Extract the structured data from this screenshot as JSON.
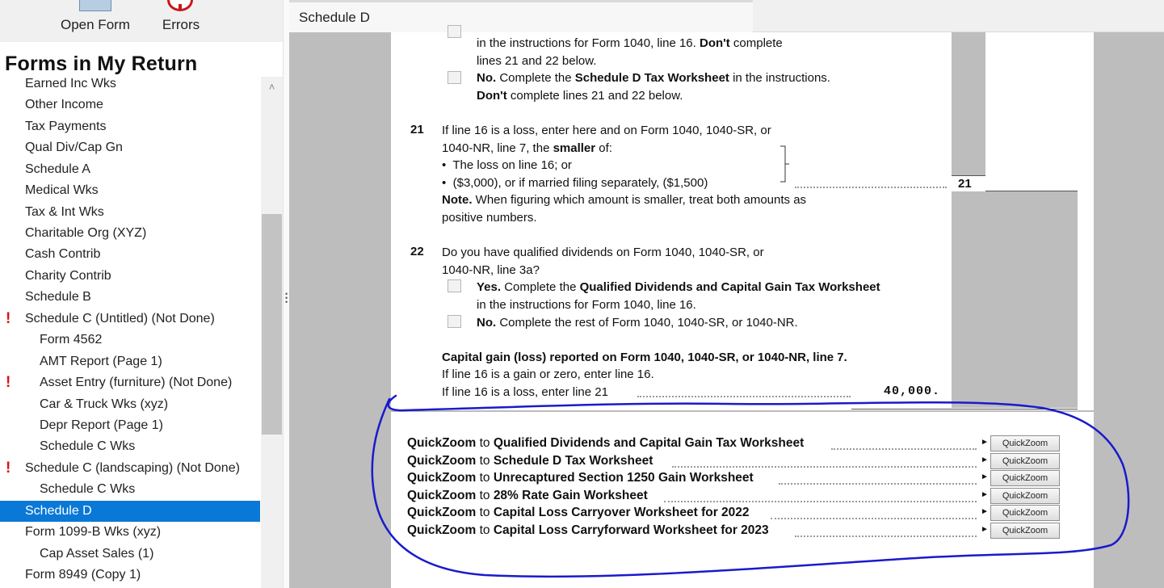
{
  "toolbar": {
    "open_form": "Open Form",
    "errors": "Errors"
  },
  "sidebar": {
    "title": "Forms in My Return",
    "items": [
      {
        "label": "Earned Inc Wks"
      },
      {
        "label": "Other Income"
      },
      {
        "label": "Tax Payments"
      },
      {
        "label": "Qual Div/Cap Gn"
      },
      {
        "label": "Schedule A"
      },
      {
        "label": "Medical Wks"
      },
      {
        "label": "Tax & Int Wks"
      },
      {
        "label": "Charitable Org (XYZ)"
      },
      {
        "label": "Cash Contrib"
      },
      {
        "label": "Charity Contrib"
      },
      {
        "label": "Schedule B"
      },
      {
        "label": "Schedule C (Untitled) (Not Done)"
      },
      {
        "label": "Form 4562"
      },
      {
        "label": "AMT Report (Page 1)"
      },
      {
        "label": "Asset Entry (furniture) (Not Done)"
      },
      {
        "label": "Car & Truck Wks (xyz)"
      },
      {
        "label": "Depr Report (Page 1)"
      },
      {
        "label": "Schedule C Wks"
      },
      {
        "label": "Schedule C (landscaping) (Not Done)"
      },
      {
        "label": "Schedule C Wks"
      },
      {
        "label": "Schedule D"
      },
      {
        "label": "Form 1099-B Wks (xyz)"
      },
      {
        "label": "Cap Asset Sales (1)"
      },
      {
        "label": "Form 8949 (Copy 1)"
      }
    ],
    "error_mark": "!"
  },
  "tab": {
    "label": "Schedule D"
  },
  "form": {
    "top_l1a": "in the instructions for Form 1040, line 16. ",
    "top_l1b": "Don't",
    "top_l1c": " complete",
    "top_l2": "lines 21 and 22 below.",
    "no_a": "No.",
    "no_b": " Complete the ",
    "no_c": "Schedule D Tax Worksheet",
    "no_d": " in the instructions.",
    "no2_a": "Don't",
    "no2_b": " complete lines 21 and 22 below.",
    "l21_num": "21",
    "l21_t1": "If line 16 is a loss, enter here and on Form 1040, 1040-SR, or",
    "l21_t2a": "1040-NR, line 7, the ",
    "l21_t2b": "smaller",
    "l21_t2c": " of:",
    "l21_b1": "The loss on line 16; or",
    "l21_b2": "($3,000), or if married filing separately, ($1,500)",
    "l21_note_a": "Note.",
    "l21_note_b": " When figuring which amount is smaller, treat both amounts as",
    "l21_note2": "positive numbers.",
    "l21_box": "21",
    "bullet": "•",
    "l22_num": "22",
    "l22_t1": "Do you have qualified dividends on Form 1040, 1040-SR, or",
    "l22_t2": "1040-NR, line 3a?",
    "yes_a": "Yes.",
    "yes_b": "  Complete the ",
    "yes_c": "Qualified Dividends and Capital Gain Tax Worksheet",
    "yes2": "in the instructions for Form 1040, line 16.",
    "no22_a": "No.",
    "no22_b": " Complete the rest of Form 1040, 1040-SR, or 1040-NR.",
    "cg_title": "Capital gain (loss) reported on Form 1040, 1040-SR, or 1040-NR, line 7.",
    "cg_l1": "If line 16 is a gain or zero, enter line 16.",
    "cg_l2": "If line 16 is a loss, enter line 21",
    "cg_value": "40,000."
  },
  "quickzoom": {
    "prefix": "QuickZoom",
    "to": " to ",
    "button_label": "QuickZoom",
    "arrow": "►",
    "rows": [
      {
        "target": "Qualified Dividends and Capital Gain Tax Worksheet"
      },
      {
        "target": "Schedule D Tax Worksheet"
      },
      {
        "target": "Unrecaptured Section 1250 Gain Worksheet"
      },
      {
        "target": "28% Rate Gain Worksheet"
      },
      {
        "target": "Capital Loss Carryover Worksheet for 2022"
      },
      {
        "target": "Capital Loss Carryforward Worksheet for 2023"
      }
    ]
  },
  "annotation_color": "#1a1acc"
}
